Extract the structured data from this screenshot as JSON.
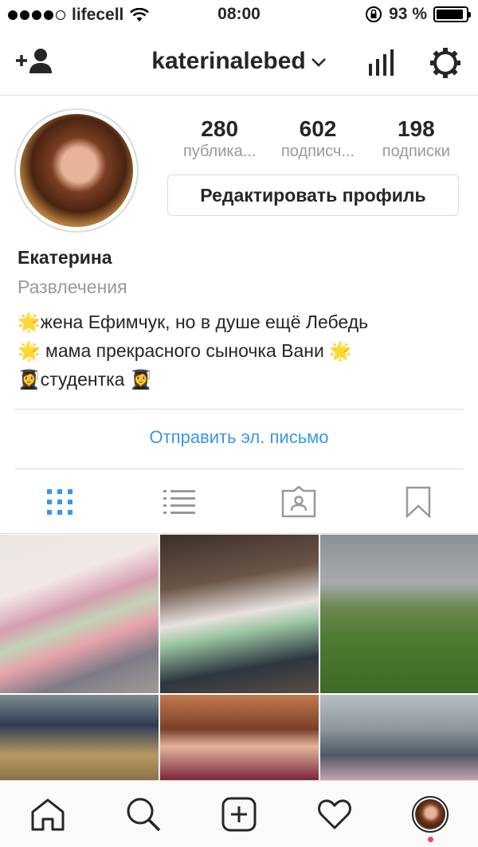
{
  "status_bar": {
    "carrier": "lifecell",
    "time": "08:00",
    "battery": "93 %",
    "battery_level": 0.93
  },
  "header": {
    "username": "katerinalebed"
  },
  "profile": {
    "stats": [
      {
        "value": "280",
        "label": "публика..."
      },
      {
        "value": "602",
        "label": "подписч..."
      },
      {
        "value": "198",
        "label": "подписки"
      }
    ],
    "edit_button": "Редактировать профиль",
    "name": "Екатерина",
    "category": "Развлечения",
    "bio_lines": [
      "🌟жена Ефимчук, но в душе ещё Лебедь",
      "🌟 мама прекрасного сыночка Вани 🌟",
      "👩‍🎓студентка 👩‍🎓"
    ],
    "email_button": "Отправить эл. письмо"
  },
  "tabs": [
    "grid-icon",
    "list-icon",
    "tagged-icon",
    "saved-icon"
  ],
  "active_tab_color": "#3897f0",
  "bottom_nav": [
    "home-icon",
    "search-icon",
    "add-icon",
    "heart-icon",
    "profile-avatar"
  ],
  "link_color": "#3897f0",
  "notification_color": "#ed4956"
}
